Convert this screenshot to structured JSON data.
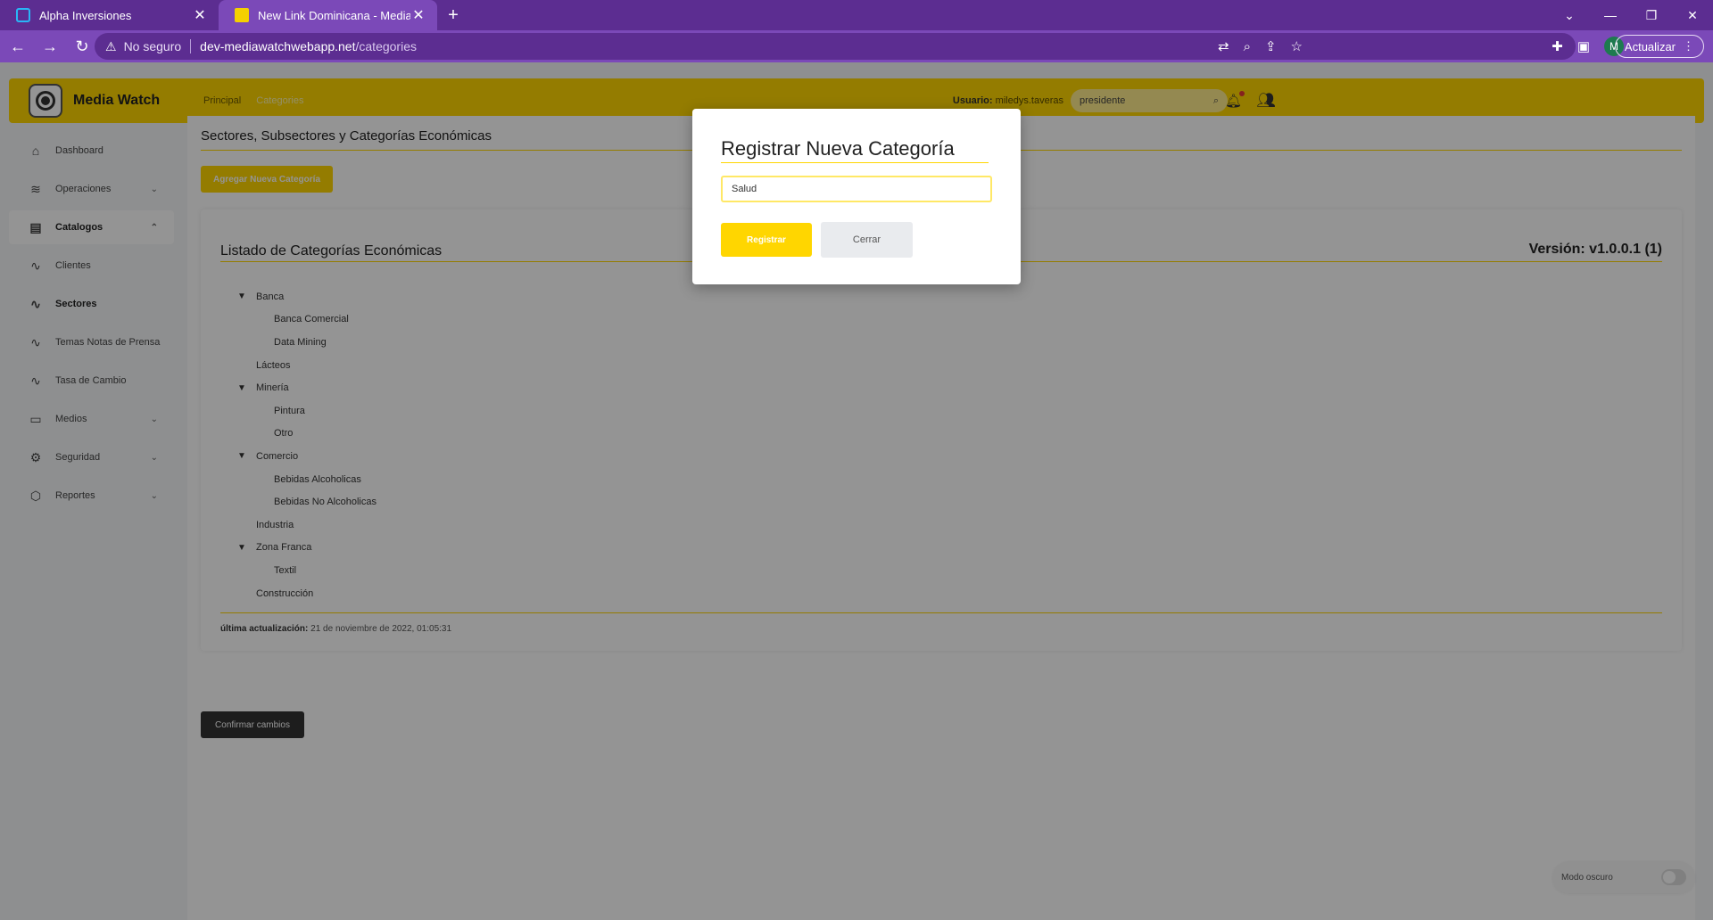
{
  "browser": {
    "tabs": [
      {
        "title": "Alpha Inversiones",
        "active": false
      },
      {
        "title": "New Link Dominicana - Media W",
        "active": true
      }
    ],
    "security_label": "No seguro",
    "url_host": "dev-mediawatchwebapp.net",
    "url_path": "/categories",
    "profile_initial": "M",
    "update_label": "Actualizar"
  },
  "header": {
    "brand": "Media Watch",
    "breadcrumb": [
      "Principal",
      "Categories"
    ],
    "user_label": "Usuario:",
    "user_name": "miledys.taveras",
    "search_value": "presidente"
  },
  "sidebar": {
    "items": [
      {
        "label": "Dashboard",
        "icon": "home-icon"
      },
      {
        "label": "Operaciones",
        "icon": "database-icon"
      },
      {
        "label": "Catalogos",
        "icon": "file-plus-icon"
      },
      {
        "label": "Clientes",
        "icon": "activity-icon"
      },
      {
        "label": "Sectores",
        "icon": "activity-icon"
      },
      {
        "label": "Temas Notas de Prensa",
        "icon": "activity-icon"
      },
      {
        "label": "Tasa de Cambio",
        "icon": "activity-icon"
      },
      {
        "label": "Medios",
        "icon": "tv-icon"
      },
      {
        "label": "Seguridad",
        "icon": "settings-icon"
      },
      {
        "label": "Reportes",
        "icon": "package-icon"
      }
    ]
  },
  "content": {
    "page_title": "Sectores, Subsectores y Categorías Económicas",
    "add_button": "Agregar Nueva Categoría",
    "card_title": "Listado de Categorías Económicas",
    "version": "Versión: v1.0.0.1 (1)",
    "tree": [
      {
        "label": "Banca",
        "children": [
          "Banca Comercial",
          "Data Mining"
        ]
      },
      {
        "label": "Lácteos",
        "children": []
      },
      {
        "label": "Minería",
        "children": [
          "Pintura",
          "Otro"
        ]
      },
      {
        "label": "Comercio",
        "children": [
          "Bebidas Alcoholicas",
          "Bebidas No Alcoholicas"
        ]
      },
      {
        "label": "Industria",
        "children": []
      },
      {
        "label": "Zona Franca",
        "children": [
          "Textil"
        ]
      },
      {
        "label": "Construcción",
        "children": []
      }
    ],
    "last_update_label": "última actualización:",
    "last_update_value": "21 de noviembre de 2022, 01:05:31",
    "confirm_button": "Confirmar cambios",
    "dark_mode_label": "Modo oscuro"
  },
  "modal": {
    "title": "Registrar Nueva Categoría",
    "input_value": "Salud",
    "register_button": "Registrar",
    "close_button": "Cerrar"
  },
  "colors": {
    "browser_frame": "#5c2d91",
    "accent": "#ffd600",
    "dark_button": "#333333"
  }
}
